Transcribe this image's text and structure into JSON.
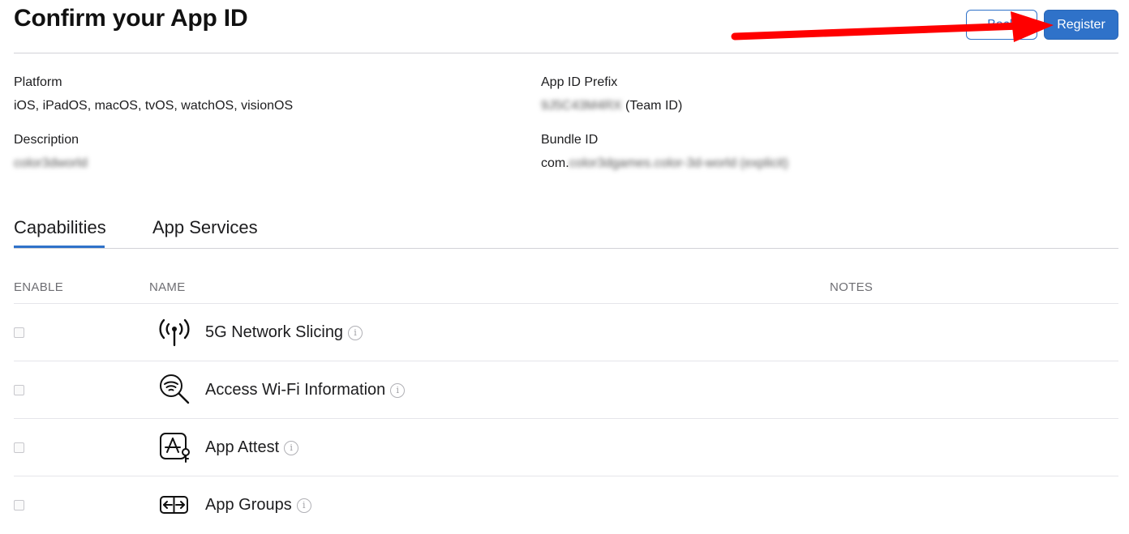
{
  "page": {
    "title": "Confirm your App ID"
  },
  "actions": {
    "back_label": "Back",
    "register_label": "Register"
  },
  "details": {
    "platform_label": "Platform",
    "platform_value": "iOS, iPadOS, macOS, tvOS, watchOS, visionOS",
    "description_label": "Description",
    "description_value": "color3dworld",
    "prefix_label": "App ID Prefix",
    "prefix_value": "9J5C43M4RX",
    "prefix_suffix": " (Team ID)",
    "bundle_label": "Bundle ID",
    "bundle_prefix": "com.",
    "bundle_value": "color3dgames.color-3d-world (explicit)"
  },
  "tabs": [
    {
      "label": "Capabilities",
      "active": true
    },
    {
      "label": "App Services",
      "active": false
    }
  ],
  "table": {
    "headers": {
      "enable": "ENABLE",
      "name": "NAME",
      "notes": "NOTES"
    },
    "rows": [
      {
        "name": "5G Network Slicing",
        "icon": "antenna-signal-icon",
        "enabled": false
      },
      {
        "name": "Access Wi-Fi Information",
        "icon": "wifi-search-icon",
        "enabled": false
      },
      {
        "name": "App Attest",
        "icon": "app-attest-key-icon",
        "enabled": false
      },
      {
        "name": "App Groups",
        "icon": "app-groups-arrows-icon",
        "enabled": false
      }
    ]
  },
  "info_glyph": "i",
  "colors": {
    "accent": "#2f72c9",
    "annotation_arrow": "#ff0000"
  }
}
